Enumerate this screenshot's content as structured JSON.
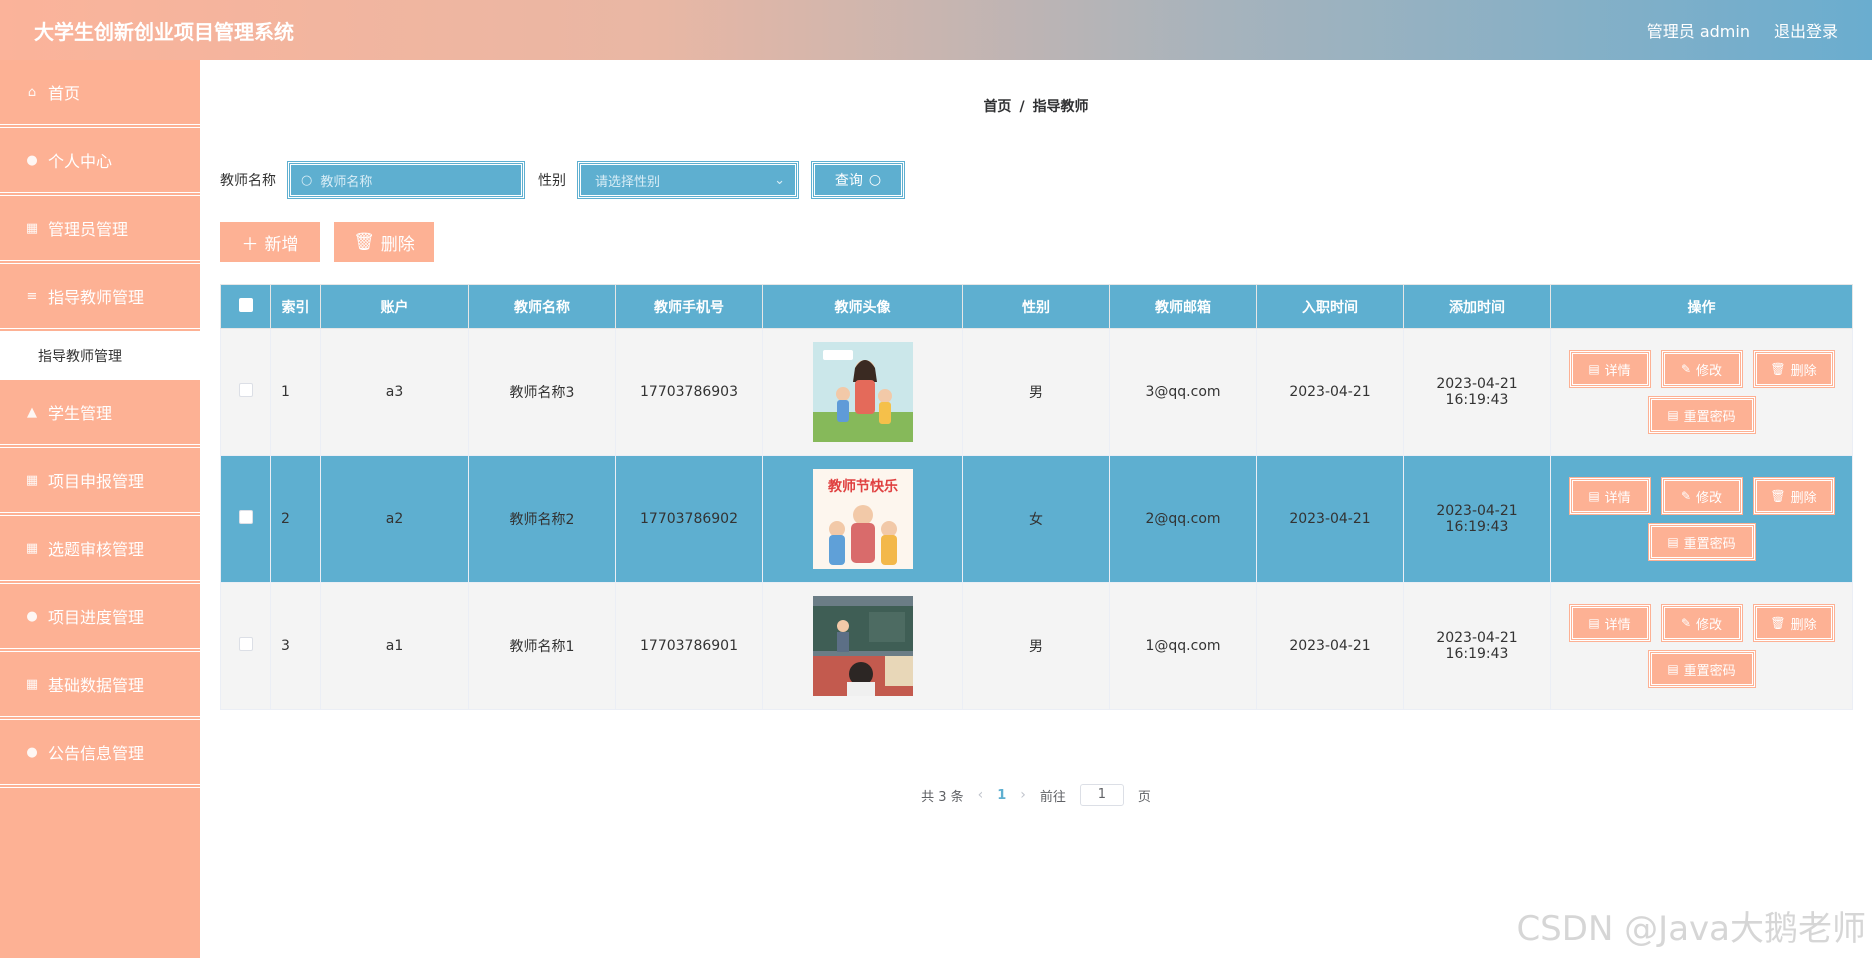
{
  "header": {
    "title": "大学生创新创业项目管理系统",
    "user": "管理员 admin",
    "logout": "退出登录"
  },
  "sidebar": {
    "items": [
      {
        "label": "首页",
        "icon": "home-icon"
      },
      {
        "label": "个人中心",
        "icon": "user-icon"
      },
      {
        "label": "管理员管理",
        "icon": "grid-icon"
      },
      {
        "label": "指导教师管理",
        "icon": "list-icon"
      },
      {
        "label": "学生管理",
        "icon": "student-icon"
      },
      {
        "label": "项目申报管理",
        "icon": "grid-icon"
      },
      {
        "label": "选题审核管理",
        "icon": "grid-icon"
      },
      {
        "label": "项目进度管理",
        "icon": "user-icon"
      },
      {
        "label": "基础数据管理",
        "icon": "grid-icon"
      },
      {
        "label": "公告信息管理",
        "icon": "user-icon"
      }
    ],
    "submenu": "指导教师管理"
  },
  "breadcrumb": {
    "home": "首页",
    "sep": "/",
    "current": "指导教师"
  },
  "search": {
    "name_label": "教师名称",
    "name_placeholder": "教师名称",
    "gender_label": "性别",
    "gender_placeholder": "请选择性别",
    "query_label": "查询"
  },
  "actions": {
    "add": "新增",
    "delete": "删除"
  },
  "table": {
    "headers": [
      "索引",
      "账户",
      "教师名称",
      "教师手机号",
      "教师头像",
      "性别",
      "教师邮箱",
      "入职时间",
      "添加时间",
      "操作"
    ],
    "rows": [
      {
        "index": "1",
        "account": "a3",
        "name": "教师名称3",
        "phone": "17703786903",
        "gender": "男",
        "email": "3@qq.com",
        "hire": "2023-04-21",
        "added": "2023-04-21 16:19:43"
      },
      {
        "index": "2",
        "account": "a2",
        "name": "教师名称2",
        "phone": "17703786902",
        "gender": "女",
        "email": "2@qq.com",
        "hire": "2023-04-21",
        "added": "2023-04-21 16:19:43"
      },
      {
        "index": "3",
        "account": "a1",
        "name": "教师名称1",
        "phone": "17703786901",
        "gender": "男",
        "email": "1@qq.com",
        "hire": "2023-04-21",
        "added": "2023-04-21 16:19:43"
      }
    ],
    "ops": {
      "detail": "详情",
      "edit": "修改",
      "delete": "删除",
      "reset": "重置密码"
    },
    "avatar_text": "教师节快乐"
  },
  "pager": {
    "total": "共 3 条",
    "current": "1",
    "goto_prefix": "前往",
    "goto_value": "1",
    "goto_suffix": "页"
  },
  "watermark": "CSDN @Java大鹅老师",
  "colors": {
    "accent_blue": "#5eafd0",
    "accent_peach": "#fdb194"
  }
}
